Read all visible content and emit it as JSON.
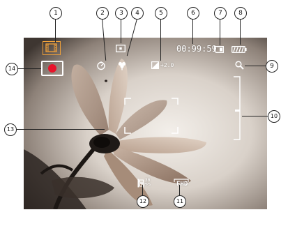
{
  "callouts": [
    "1",
    "2",
    "3",
    "4",
    "5",
    "6",
    "7",
    "8",
    "9",
    "10",
    "11",
    "12",
    "13",
    "14"
  ],
  "screen": {
    "time_remaining": "00:99:59",
    "ev_value": "+2.0",
    "video_quality": "FHD",
    "frame_rate_top": "30",
    "frame_rate_bottom": "FPS"
  },
  "colors": {
    "mode_icon": "#f2a23a",
    "record_dot": "#e8132a",
    "osd": "#ffffff"
  },
  "icons": [
    "movie-mode-icon",
    "self-timer-icon",
    "metering-icon",
    "macro-icon",
    "ev-icon",
    "sd-card-icon",
    "battery-icon",
    "zoom-icon",
    "zoom-bar-icon",
    "video-quality-icon",
    "frame-rate-icon",
    "focus-frame-icon",
    "record-button-icon"
  ]
}
